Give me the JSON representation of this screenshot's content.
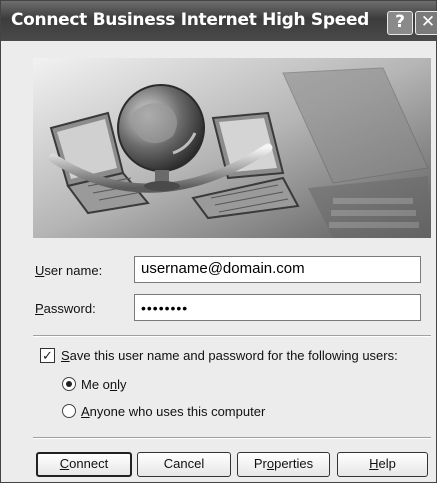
{
  "window": {
    "title": "Connect Business Internet High Speed",
    "help_glyph": "?",
    "close_glyph": "✕"
  },
  "form": {
    "username_label_access": "U",
    "username_label_rest": "ser name:",
    "username_value": "username@domain.com",
    "password_label_access": "P",
    "password_label_rest": "assword:",
    "password_value": "••••••••",
    "save_checked": true,
    "save_label_access": "S",
    "save_label_rest": "ave this user name and password for the following users:",
    "me_only_pre": "Me o",
    "me_only_access": "n",
    "me_only_post": "ly",
    "me_only_selected": true,
    "anyone_access": "A",
    "anyone_rest": "nyone who uses this computer",
    "anyone_selected": false
  },
  "buttons": {
    "connect_access": "C",
    "connect_rest": "onnect",
    "cancel": "Cancel",
    "properties_pre": "Pr",
    "properties_access": "o",
    "properties_post": "perties",
    "help_access": "H",
    "help_rest": "elp"
  },
  "icons": [
    "globe-icon",
    "laptop-icon",
    "help-icon",
    "close-icon",
    "checkmark-icon"
  ]
}
